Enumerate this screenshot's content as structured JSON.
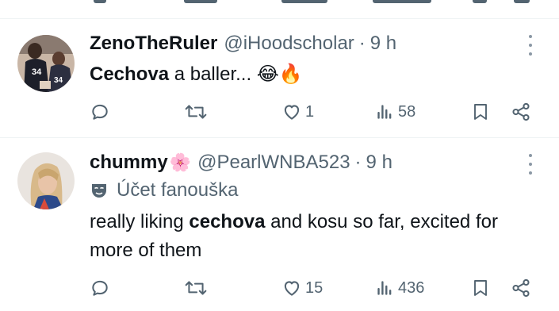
{
  "tweets": [
    {
      "display_name": "ZenoTheRuler",
      "handle": "@iHoodscholar",
      "separator": "·",
      "time": "9 h",
      "text_bold": "Cechova",
      "text_rest": " a baller...",
      "emojis": [
        "😂",
        "🔥"
      ],
      "replies": "",
      "retweets": "",
      "likes": "1",
      "views": "58"
    },
    {
      "display_name": "chummy",
      "name_emoji": "🌸",
      "handle": "@PearlWNBA523",
      "separator": "·",
      "time": "9 h",
      "fan_label": "Účet fanouška",
      "text_pre": "really liking ",
      "text_bold": "cechova",
      "text_post": " and kosu so far, excited for more of them",
      "replies": "",
      "retweets": "",
      "likes": "15",
      "views": "436"
    }
  ],
  "icons": {
    "reply": "reply-icon",
    "retweet": "retweet-icon",
    "like": "heart-icon",
    "views": "views-icon",
    "bookmark": "bookmark-icon",
    "share": "share-icon",
    "more": "more-icon",
    "fan": "mask-icon"
  },
  "colors": {
    "text": "#0f1419",
    "secondary": "#536471",
    "divider": "#eff3f4"
  }
}
